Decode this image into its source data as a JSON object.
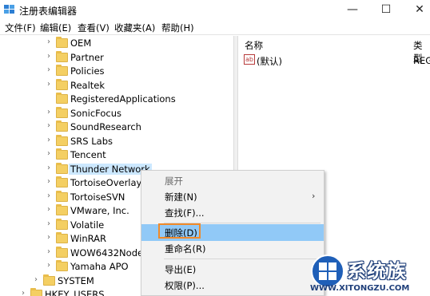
{
  "window": {
    "title": "注册表编辑器",
    "minimize_glyph": "—",
    "maximize_glyph": "☐",
    "close_glyph": "✕"
  },
  "menu": [
    "文件(F)",
    "编辑(E)",
    "查看(V)",
    "收藏夹(A)",
    "帮助(H)"
  ],
  "tree": {
    "items": [
      {
        "label": "OEM",
        "arrow": "›"
      },
      {
        "label": "Partner",
        "arrow": "›"
      },
      {
        "label": "Policies",
        "arrow": "›"
      },
      {
        "label": "Realtek",
        "arrow": "›"
      },
      {
        "label": "RegisteredApplications",
        "arrow": ""
      },
      {
        "label": "SonicFocus",
        "arrow": "›"
      },
      {
        "label": "SoundResearch",
        "arrow": "›"
      },
      {
        "label": "SRS Labs",
        "arrow": "›"
      },
      {
        "label": "Tencent",
        "arrow": "›"
      },
      {
        "label": "Thunder Network",
        "arrow": "›"
      },
      {
        "label": "TortoiseOverlays",
        "arrow": "›"
      },
      {
        "label": "TortoiseSVN",
        "arrow": "›"
      },
      {
        "label": "VMware, Inc.",
        "arrow": "›"
      },
      {
        "label": "Volatile",
        "arrow": "›"
      },
      {
        "label": "WinRAR",
        "arrow": "›"
      },
      {
        "label": "WOW6432Node",
        "arrow": "›"
      },
      {
        "label": "Yamaha APO",
        "arrow": "›"
      }
    ],
    "system": {
      "label": "SYSTEM",
      "arrow": "›"
    },
    "hkey_users": {
      "label": "HKEY_USERS",
      "arrow": "›"
    }
  },
  "right_pane": {
    "col_name": "名称",
    "col_type": "类型",
    "value_icon_text": "ab",
    "value_name": "(默认)",
    "value_type": "REG"
  },
  "context_menu": {
    "expand": "展开",
    "new": "新建(N)",
    "new_arrow": "›",
    "find": "查找(F)...",
    "delete": "删除(D)",
    "rename": "重命名(R)",
    "export": "导出(E)",
    "permissions": "权限(P)..."
  },
  "watermark": {
    "brand": "系统族",
    "url": "WWW.XITONGZU.COM"
  },
  "colors": {
    "selection": "#cce8ff",
    "menu_highlight": "#91c9f7",
    "callout": "#f08a2a",
    "folder": "#f4cf63"
  }
}
